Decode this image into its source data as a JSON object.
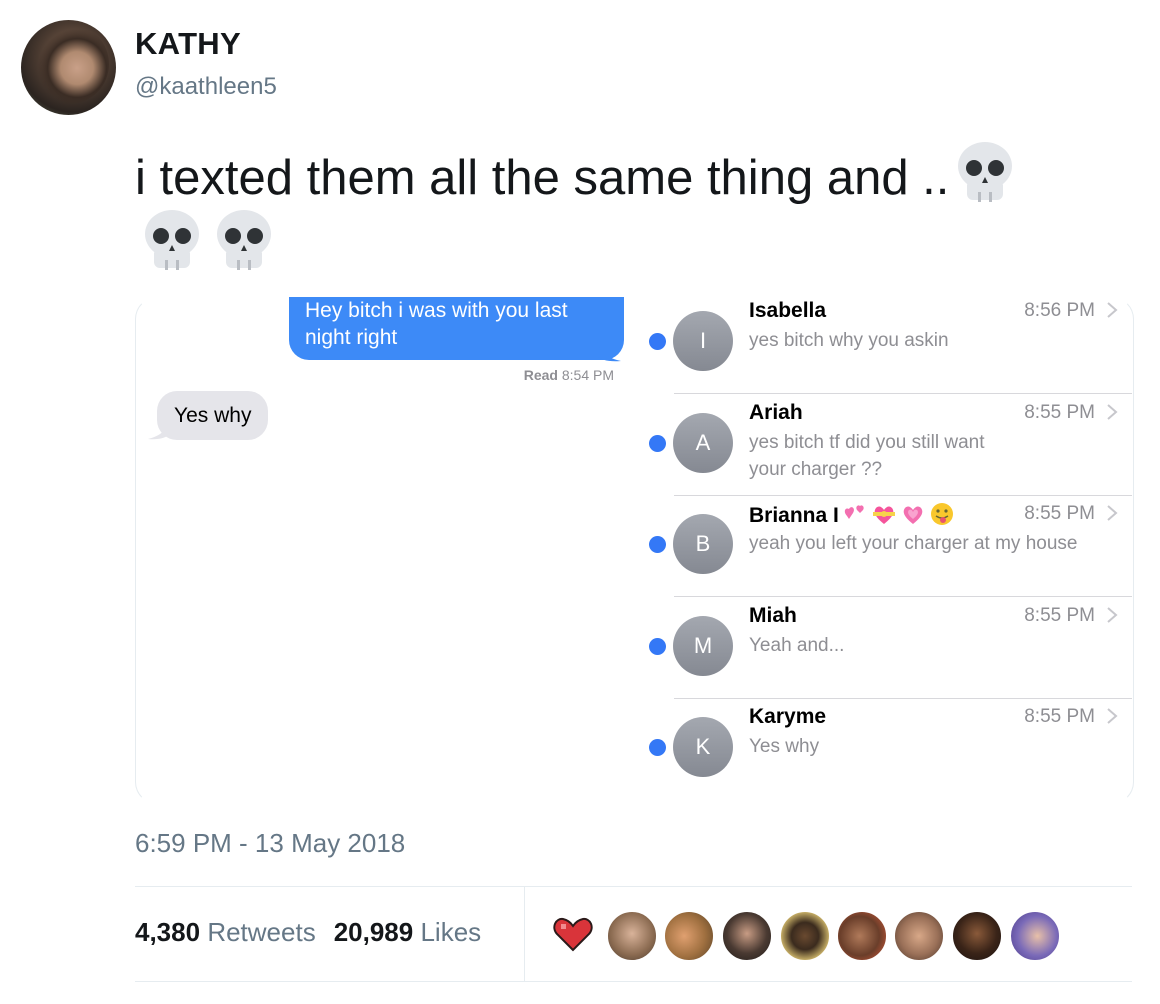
{
  "user": {
    "name": "KATHY",
    "handle": "@kaathleen5"
  },
  "tweet": {
    "text": "i texted them all the same thing and ..",
    "icons": [
      "skull-emoji",
      "skull-emoji",
      "skull-emoji"
    ]
  },
  "screenshot": {
    "sent_message": "Hey bitch i was with you last night right",
    "read_label": "Read",
    "read_time": "8:54 PM",
    "reply": "Yes why",
    "conversations": [
      {
        "initial": "I",
        "name": "Isabella",
        "time": "8:56 PM",
        "message": "yes bitch why you askin"
      },
      {
        "initial": "A",
        "name": "Ariah",
        "time": "8:55 PM",
        "message": "yes bitch tf did you still want your charger ??"
      },
      {
        "initial": "B",
        "name": "Brianna I",
        "time": "8:55 PM",
        "message": "yeah you left your charger at my house",
        "name_emojis": [
          "two-hearts",
          "heart-with-ribbon",
          "growing-heart",
          "tongue-face"
        ]
      },
      {
        "initial": "M",
        "name": "Miah",
        "time": "8:55 PM",
        "message": "Yeah and..."
      },
      {
        "initial": "K",
        "name": "Karyme",
        "time": "8:55 PM",
        "message": "Yes why"
      }
    ]
  },
  "meta": {
    "timestamp": "6:59 PM - 13 May 2018",
    "retweets_count": "4,380",
    "retweets_label": "Retweets",
    "likes_count": "20,989",
    "likes_label": "Likes"
  },
  "colors": {
    "imessage_blue": "#3d8af7",
    "unread_dot": "#3478f6",
    "twitter_gray": "#657786"
  }
}
